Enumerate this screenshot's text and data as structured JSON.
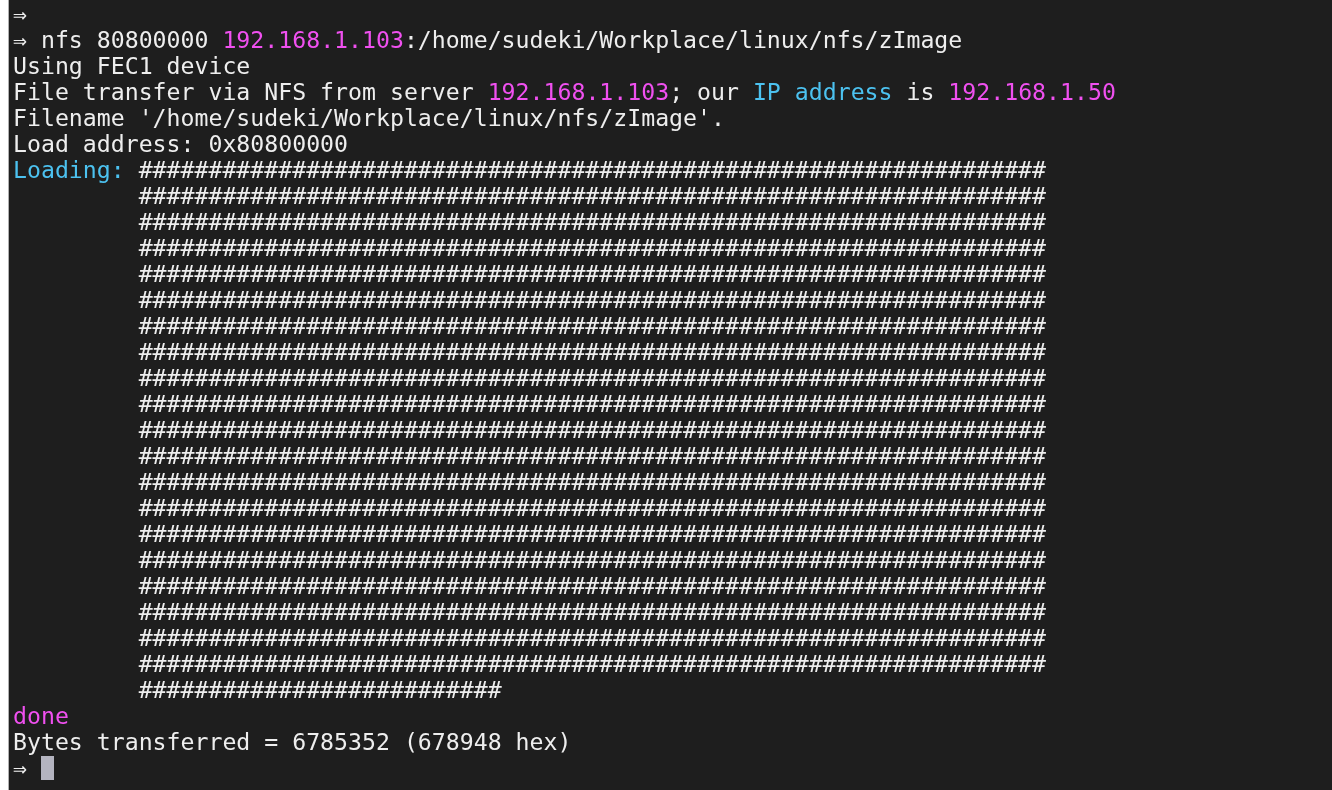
{
  "lines_before": [
    {
      "segments": [
        {
          "text": "⇒",
          "color": "#eeeeee"
        }
      ]
    },
    {
      "segments": [
        {
          "text": "⇒ nfs 80800000 ",
          "color": "#eeeeee"
        },
        {
          "text": "192.168.1.103",
          "color": "#f050f0"
        },
        {
          "text": ":/home/sudeki/Workplace/linux/nfs/zImage",
          "color": "#eeeeee"
        }
      ]
    },
    {
      "segments": [
        {
          "text": "Using FEC1 device",
          "color": "#eeeeee"
        }
      ]
    },
    {
      "segments": [
        {
          "text": "File transfer via NFS from server ",
          "color": "#eeeeee"
        },
        {
          "text": "192.168.1.103",
          "color": "#f050f0"
        },
        {
          "text": "; our ",
          "color": "#eeeeee"
        },
        {
          "text": "IP address",
          "color": "#4cc2f0"
        },
        {
          "text": " is ",
          "color": "#eeeeee"
        },
        {
          "text": "192.168.1.50",
          "color": "#f050f0"
        }
      ]
    },
    {
      "segments": [
        {
          "text": "Filename '/home/sudeki/Workplace/linux/nfs/zImage'.",
          "color": "#eeeeee"
        }
      ]
    },
    {
      "segments": [
        {
          "text": "Load address: 0x80800000",
          "color": "#eeeeee"
        }
      ]
    }
  ],
  "loading": {
    "label": "Loading:",
    "rows": [
      "#################################################################",
      "#################################################################",
      "#################################################################",
      "#################################################################",
      "#################################################################",
      "#################################################################",
      "#################################################################",
      "#################################################################",
      "#################################################################",
      "#################################################################",
      "#################################################################",
      "#################################################################",
      "#################################################################",
      "#################################################################",
      "#################################################################",
      "#################################################################",
      "#################################################################",
      "#################################################################",
      "#################################################################",
      "#################################################################",
      "##########################"
    ]
  },
  "lines_after": [
    {
      "segments": [
        {
          "text": "done",
          "color": "#f050f0"
        }
      ]
    },
    {
      "segments": [
        {
          "text": "Bytes transferred = 6785352 (678948 hex)",
          "color": "#eeeeee"
        }
      ]
    }
  ],
  "prompt": {
    "text": "⇒"
  }
}
